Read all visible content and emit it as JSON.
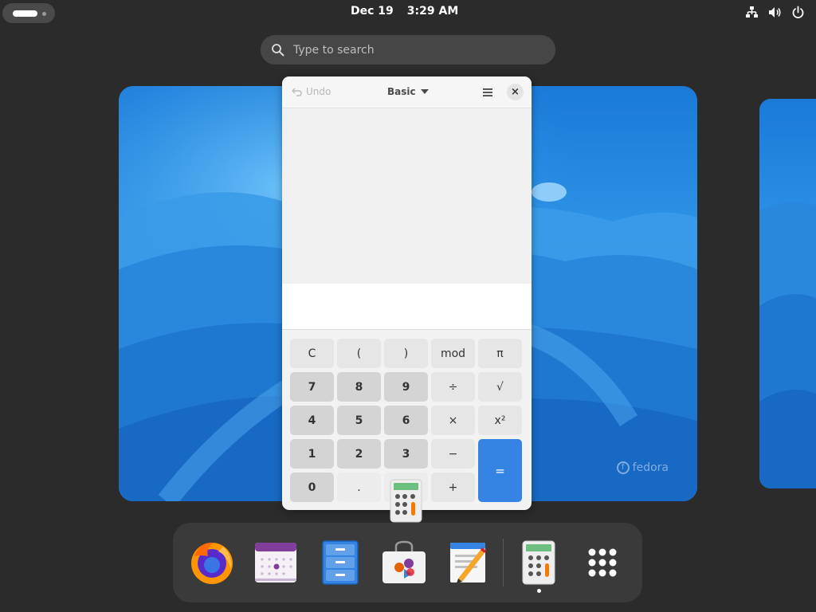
{
  "topbar": {
    "date": "Dec 19",
    "time": "3:29 AM",
    "tray_icons": [
      "network-icon",
      "volume-icon",
      "power-icon"
    ]
  },
  "search": {
    "placeholder": "Type to search",
    "value": ""
  },
  "calculator": {
    "undo_label": "Undo",
    "mode_label": "Basic",
    "display_value": "",
    "keys": [
      [
        "C",
        "(",
        ")",
        "mod",
        "π"
      ],
      [
        "7",
        "8",
        "9",
        "÷",
        "√"
      ],
      [
        "4",
        "5",
        "6",
        "×",
        "x²"
      ],
      [
        "1",
        "2",
        "3",
        "−",
        "="
      ],
      [
        "0",
        ".",
        "",
        "+"
      ]
    ]
  },
  "workspace": {
    "watermark": "fedora"
  },
  "dock": {
    "apps": [
      "firefox-icon",
      "calendar-icon",
      "files-icon",
      "software-icon",
      "text-editor-icon",
      "calculator-icon",
      "app-grid-icon"
    ]
  },
  "colors": {
    "accent": "#3584e4",
    "panel": "#2b2b2b",
    "dock": "#3a3a3a"
  }
}
